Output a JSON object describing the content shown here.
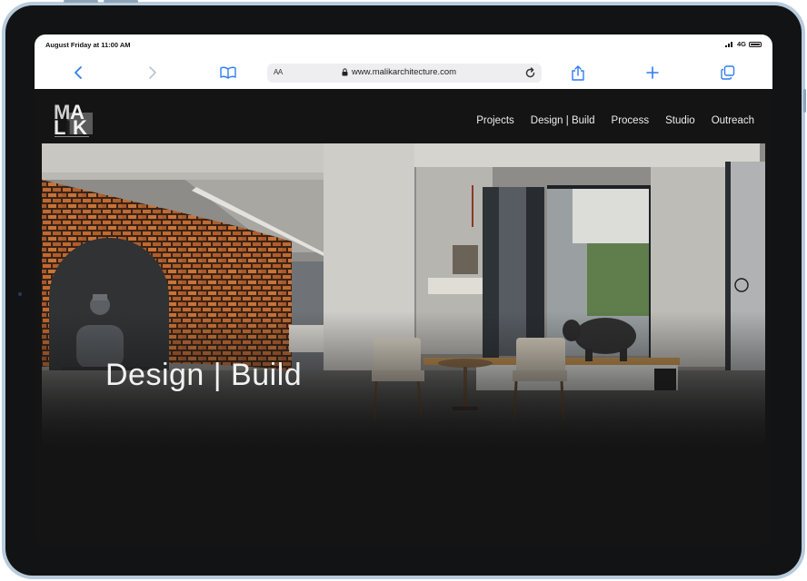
{
  "status_bar": {
    "time": "August Friday at 11:00 AM",
    "network": "4G"
  },
  "browser": {
    "text_size_label": "AA",
    "url": "www.malikarchitecture.com",
    "icons": [
      "back-icon",
      "forward-icon",
      "bookmarks-icon",
      "lock-icon",
      "reload-icon",
      "share-icon",
      "new-tab-icon",
      "tabs-icon"
    ]
  },
  "site": {
    "logo_text": "MALIK",
    "nav": [
      "Projects",
      "Design | Build",
      "Process",
      "Studio",
      "Outreach"
    ],
    "hero_title": "Design | Build"
  },
  "colors": {
    "accent": "#2f7cf6",
    "page_bg": "#141414",
    "device_frame": "#b7cbdc",
    "brick": "#b9622c"
  }
}
